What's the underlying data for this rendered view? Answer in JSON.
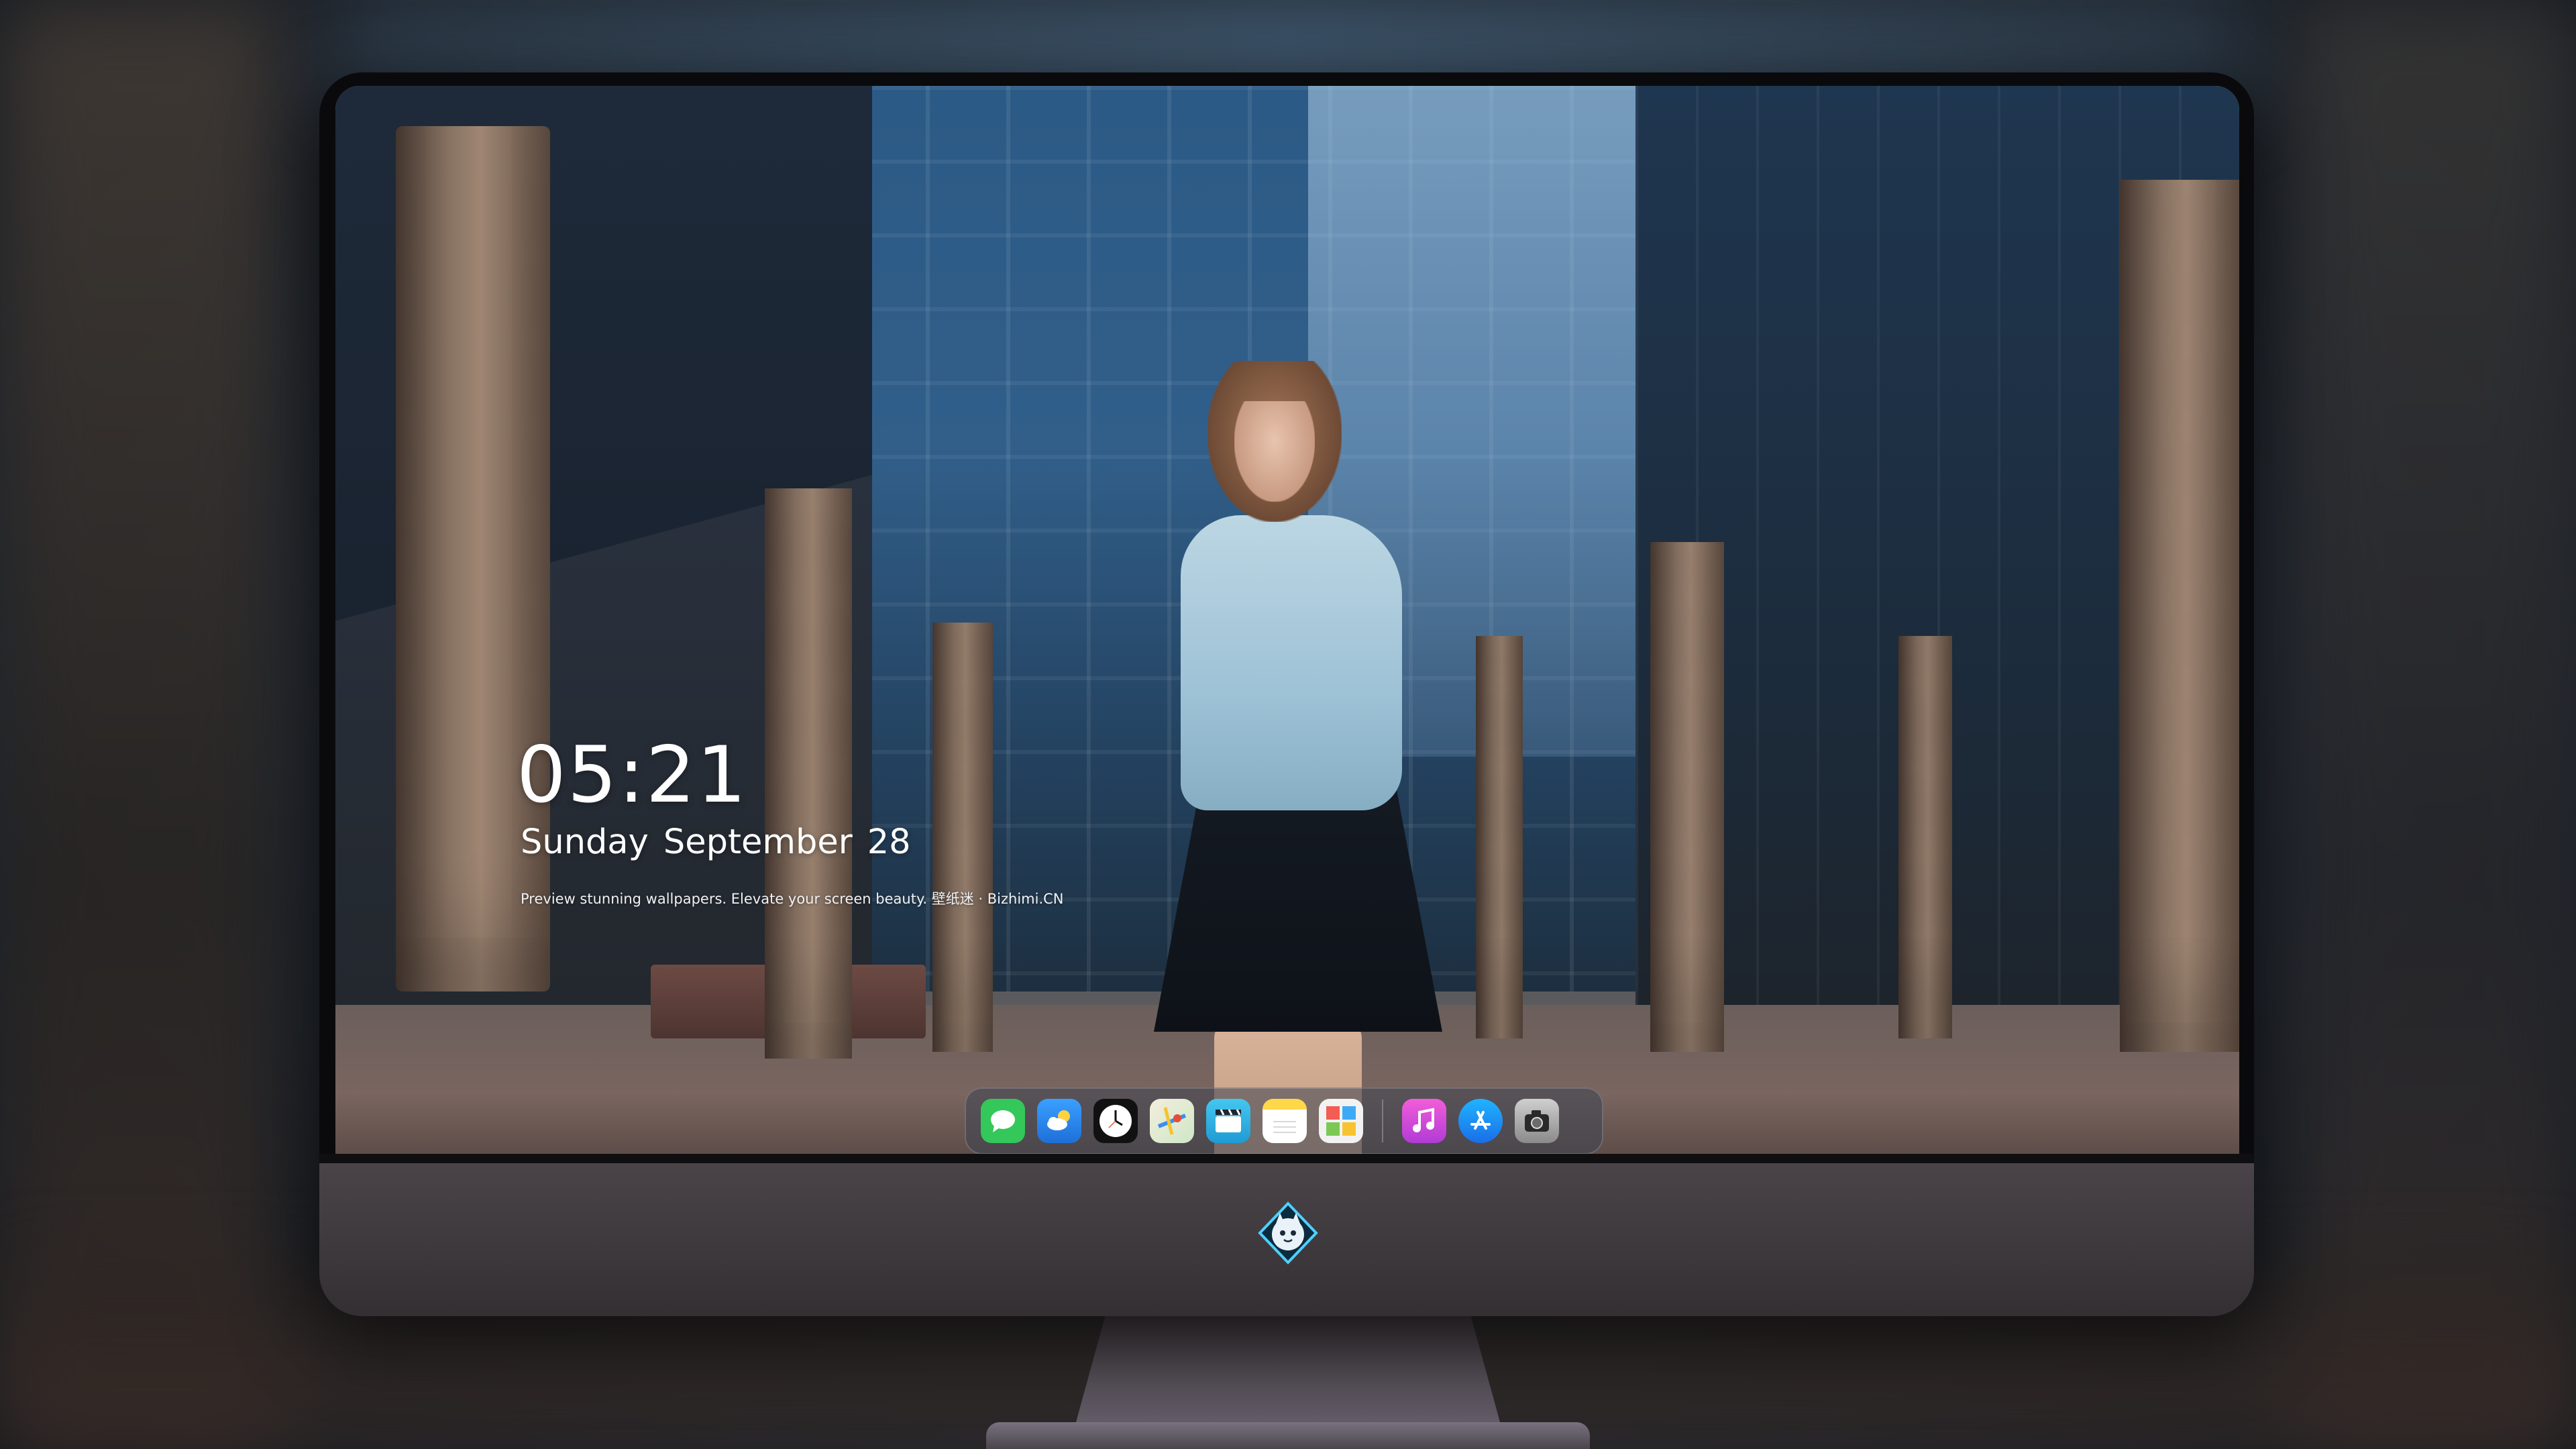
{
  "lockscreen": {
    "time": "05:21",
    "weekday": "Sunday",
    "month": "September",
    "day": "28",
    "tagline": "Preview stunning wallpapers. Elevate your screen beauty. 壁纸迷 · Bizhimi.CN"
  },
  "dock": {
    "apps": [
      {
        "icon": "messages-icon",
        "color": "#34c759"
      },
      {
        "icon": "weather-icon",
        "color": "#2f8cf0"
      },
      {
        "icon": "clock-icon",
        "color": "#111111"
      },
      {
        "icon": "maps-icon",
        "color": "#e9e4d4"
      },
      {
        "icon": "clips-icon",
        "color": "#30b8e8"
      },
      {
        "icon": "notes-icon",
        "color": "#ffd84a"
      },
      {
        "icon": "photos-icon",
        "color": "#f2f2f2"
      },
      {
        "icon": "music-icon",
        "color": "#e648d6"
      },
      {
        "icon": "app-store-icon",
        "color": "#1a8cf0"
      },
      {
        "icon": "camera-icon",
        "color": "#9a9a9a"
      }
    ]
  },
  "brand": {
    "logo_icon": "cat-mascot-logo-icon"
  }
}
